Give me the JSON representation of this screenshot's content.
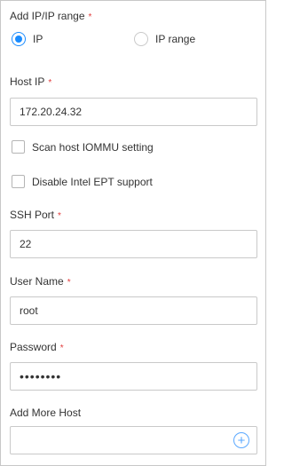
{
  "form": {
    "ip_range_label": "Add IP/IP range",
    "required_mark": "*",
    "radio_ip_label": "IP",
    "radio_ip_range_label": "IP range",
    "host_ip_label": "Host IP",
    "host_ip_value": "172.20.24.32",
    "scan_iommu_label": "Scan host IOMMU setting",
    "disable_ept_label": "Disable Intel EPT support",
    "ssh_port_label": "SSH Port",
    "ssh_port_value": "22",
    "user_name_label": "User Name",
    "user_name_value": "root",
    "password_label": "Password",
    "password_value": "••••••••",
    "add_more_label": "Add More Host",
    "add_more_value": ""
  },
  "colors": {
    "accent": "#1a8cff",
    "required": "#e23c3c",
    "border": "#c9c9c9"
  },
  "icons": {
    "add": "plus-circle-icon"
  }
}
